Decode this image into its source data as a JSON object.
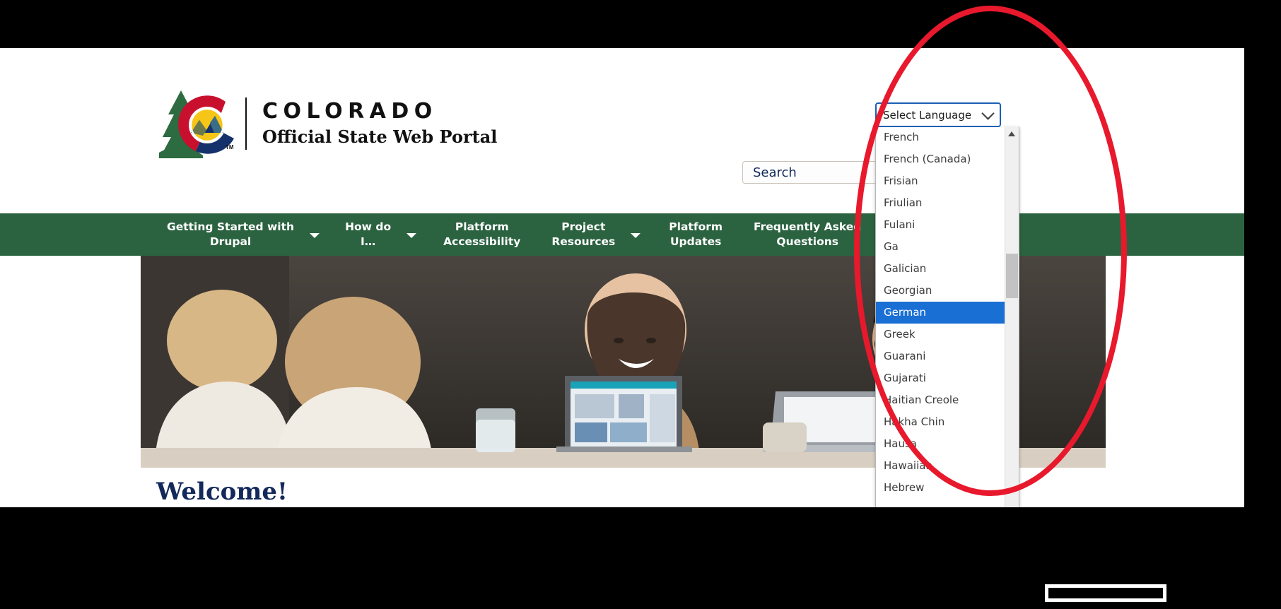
{
  "browser": {
    "page_background": "#ffffff",
    "surround_color": "#000000"
  },
  "header": {
    "logo": {
      "name": "colorado-state-logo",
      "title": "COLORADO",
      "subtitle": "Official State Web Portal",
      "trademark": "TM",
      "colors": {
        "tree_green": "#2d6b40",
        "c_red": "#c8102e",
        "c_blue": "#15316b",
        "sun_yellow": "#f5c518"
      }
    },
    "search": {
      "label": "Search",
      "placeholder": "Search",
      "value": ""
    }
  },
  "nav": {
    "background": "#2b6340",
    "items": [
      {
        "label": "Getting Started with\nDrupal",
        "has_dropdown": true
      },
      {
        "label": "How do\nI…",
        "has_dropdown": true
      },
      {
        "label": "Platform\nAccessibility",
        "has_dropdown": false
      },
      {
        "label": "Project\nResources",
        "has_dropdown": true
      },
      {
        "label": "Platform\nUpdates",
        "has_dropdown": false
      },
      {
        "label": "Frequently Asked\nQuestions",
        "has_dropdown": false
      }
    ]
  },
  "hero": {
    "alt": "Three people smiling and working on laptops at a cafe table"
  },
  "main": {
    "welcome_heading": "Welcome!"
  },
  "language_select": {
    "button_label": "Select Language",
    "selected_option": "German",
    "expanded": true,
    "highlight_color": "#1a6fd4",
    "border_color": "#1a5fb4",
    "options": [
      "French",
      "French (Canada)",
      "Frisian",
      "Friulian",
      "Fulani",
      "Ga",
      "Galician",
      "Georgian",
      "German",
      "Greek",
      "Guarani",
      "Gujarati",
      "Haitian Creole",
      "Hakha Chin",
      "Hausa",
      "Hawaiian",
      "Hebrew"
    ],
    "scrollbar": {
      "up_arrow": "▲",
      "thumb_position": "upper-middle"
    }
  },
  "annotations": {
    "ellipse_color": "#e8192c",
    "ellipse_target": "language-select-dropdown",
    "bottom_rect_color": "#ffffff"
  }
}
